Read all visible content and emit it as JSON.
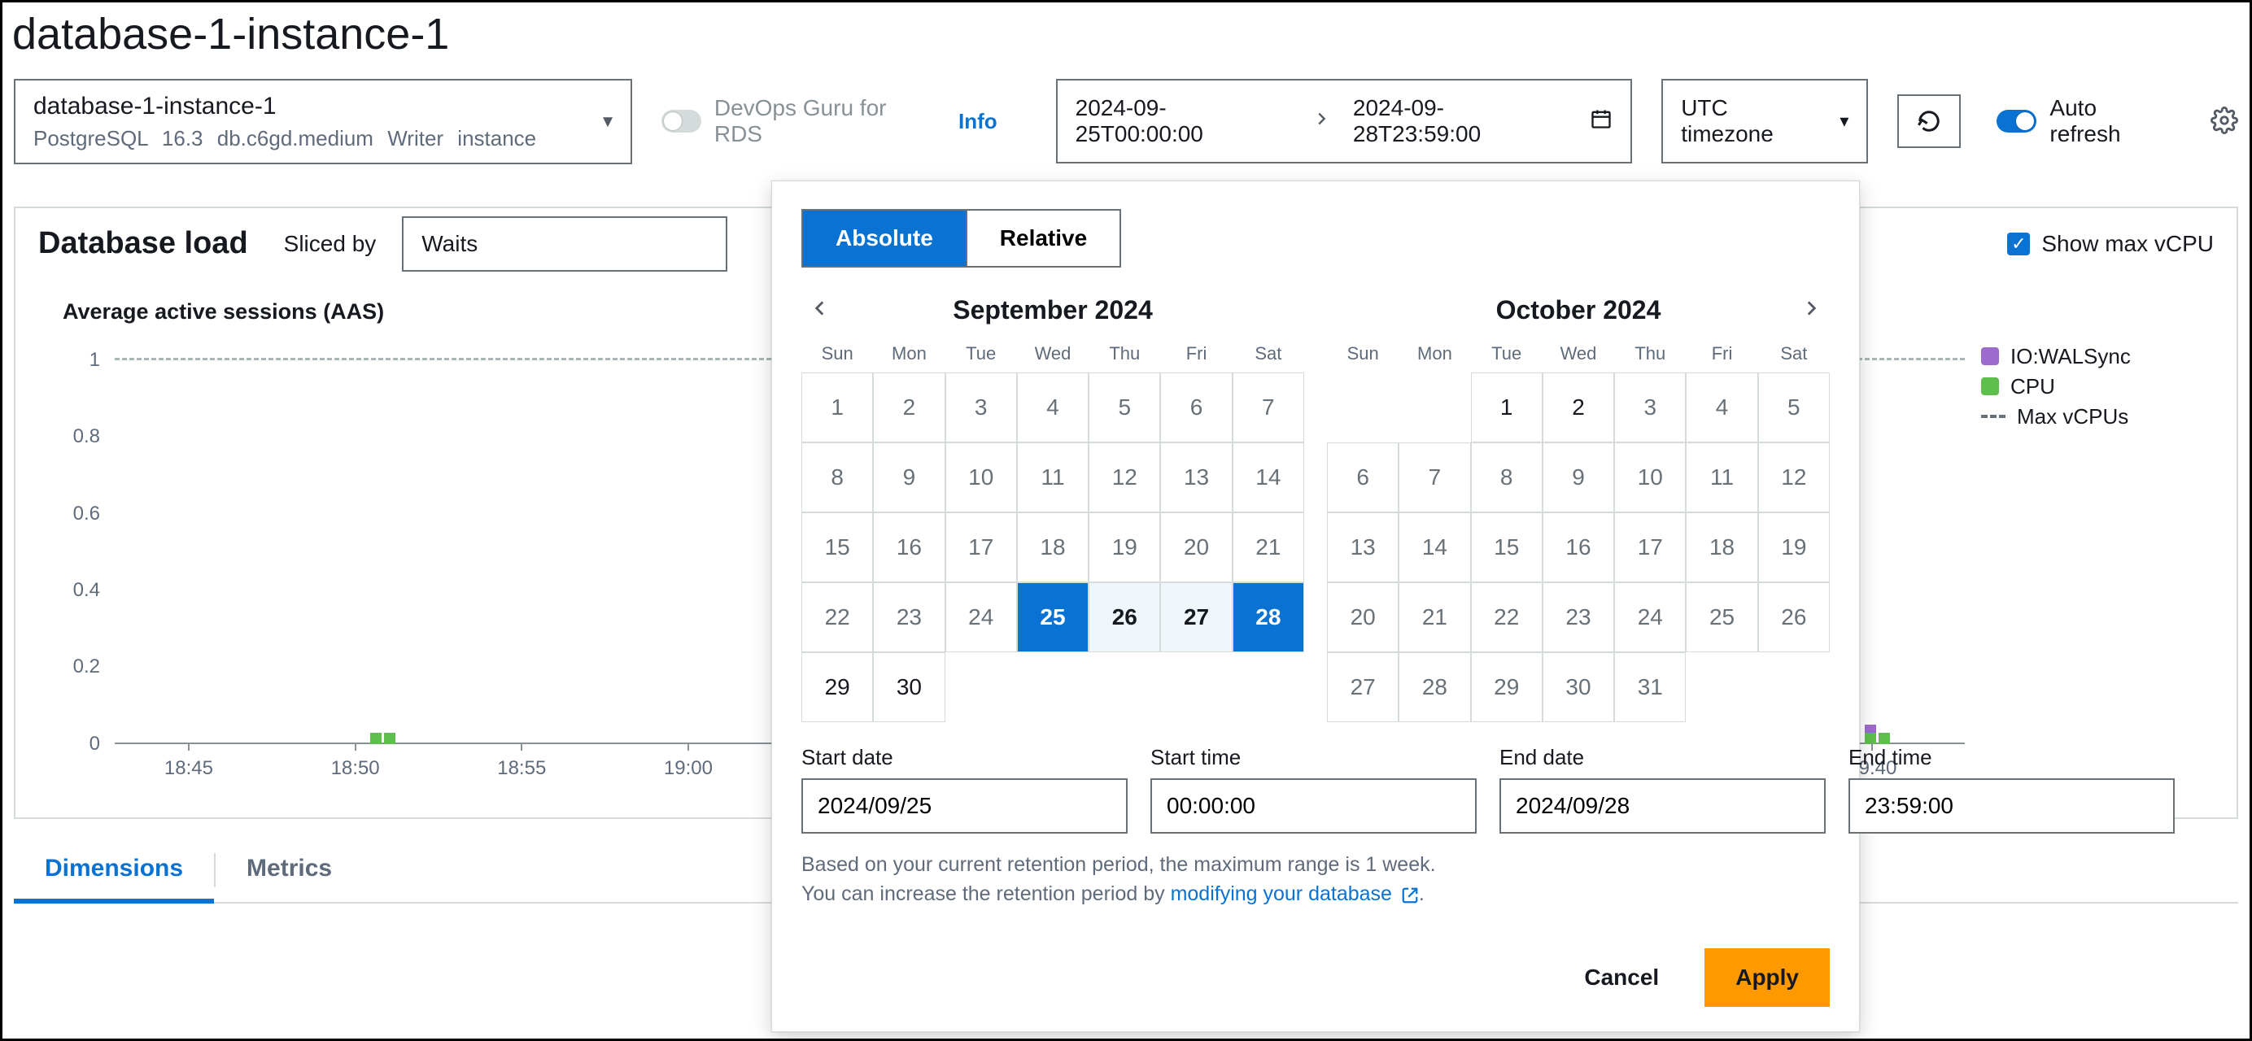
{
  "page_title": "database-1-instance-1",
  "db_select": {
    "name": "database-1-instance-1",
    "engine": "PostgreSQL",
    "version": "16.3",
    "class": "db.c6gd.medium",
    "role": "Writer instance"
  },
  "devops_guru": {
    "label": "DevOps Guru for RDS",
    "enabled": false,
    "info": "Info"
  },
  "daterange": {
    "start_display": "2024-09-25T00:00:00",
    "end_display": "2024-09-28T23:59:00"
  },
  "timezone": {
    "label": "UTC timezone"
  },
  "auto_refresh": {
    "label": "Auto refresh",
    "enabled": true
  },
  "load": {
    "title": "Database load",
    "sliced_by_label": "Sliced by",
    "sliced_by_value": "Waits",
    "show_max_vcpu_label": "Show max vCPU",
    "show_max_vcpu_checked": true,
    "subtitle": "Average active sessions (AAS)",
    "legend": {
      "io_walsync": {
        "label": "IO:WALSync",
        "color": "#9d6bce"
      },
      "cpu": {
        "label": "CPU",
        "color": "#5fbf4c"
      },
      "max_vcpu": {
        "label": "Max vCPUs"
      }
    }
  },
  "chart_data": {
    "type": "bar",
    "title": "Average active sessions (AAS)",
    "xlabel": "",
    "ylabel": "",
    "ylim": [
      0,
      1
    ],
    "y_ticks": [
      0,
      0.2,
      0.4,
      0.6,
      0.8,
      1
    ],
    "x_ticks": [
      "18:45",
      "18:50",
      "18:55",
      "19:00",
      "19:40"
    ],
    "max_vcpu_line": 1,
    "series": [
      {
        "name": "IO:WALSync",
        "color": "#9d6bce"
      },
      {
        "name": "CPU",
        "color": "#5fbf4c"
      }
    ],
    "visible_bars": [
      {
        "x": "18:51",
        "stack": [
          {
            "series": "CPU",
            "value": 0.03
          }
        ]
      },
      {
        "x": "18:52",
        "stack": [
          {
            "series": "CPU",
            "value": 0.03
          }
        ]
      },
      {
        "x": "19:40",
        "stack": [
          {
            "series": "CPU",
            "value": 0.03
          },
          {
            "series": "IO:WALSync",
            "value": 0.02
          }
        ]
      },
      {
        "x": "19:41",
        "stack": [
          {
            "series": "CPU",
            "value": 0.03
          }
        ]
      }
    ]
  },
  "tabs": {
    "items": [
      "Dimensions",
      "Metrics"
    ],
    "active": 0
  },
  "popover": {
    "modes": {
      "absolute": "Absolute",
      "relative": "Relative",
      "active": "absolute"
    },
    "left_month": {
      "title": "September 2024",
      "dow": [
        "Sun",
        "Mon",
        "Tue",
        "Wed",
        "Thu",
        "Fri",
        "Sat"
      ],
      "days": [
        1,
        2,
        3,
        4,
        5,
        6,
        7,
        8,
        9,
        10,
        11,
        12,
        13,
        14,
        15,
        16,
        17,
        18,
        19,
        20,
        21,
        22,
        23,
        24,
        25,
        26,
        27,
        28,
        29,
        30
      ],
      "enabled_from": 25,
      "sel_start": 25,
      "sel_end": 28
    },
    "right_month": {
      "title": "October 2024",
      "dow": [
        "Sun",
        "Mon",
        "Tue",
        "Wed",
        "Thu",
        "Fri",
        "Sat"
      ],
      "lead_blanks": 2,
      "days_first_row": [
        1,
        2,
        3,
        4,
        5
      ],
      "days_rest": [
        6,
        7,
        8,
        9,
        10,
        11,
        12,
        13,
        14,
        15,
        16,
        17,
        18,
        19,
        20,
        21,
        22,
        23,
        24,
        25,
        26,
        27,
        28,
        29,
        30,
        31
      ],
      "enabled_max": 2
    },
    "fields": {
      "start_date_label": "Start date",
      "start_date": "2024/09/25",
      "start_time_label": "Start time",
      "start_time": "00:00:00",
      "end_date_label": "End date",
      "end_date": "2024/09/28",
      "end_time_label": "End time",
      "end_time": "23:59:00"
    },
    "retention": {
      "line1": "Based on your current retention period, the maximum range is 1 week.",
      "line2_prefix": "You can increase the retention period by ",
      "link_text": "modifying your database"
    },
    "actions": {
      "cancel": "Cancel",
      "apply": "Apply"
    }
  }
}
